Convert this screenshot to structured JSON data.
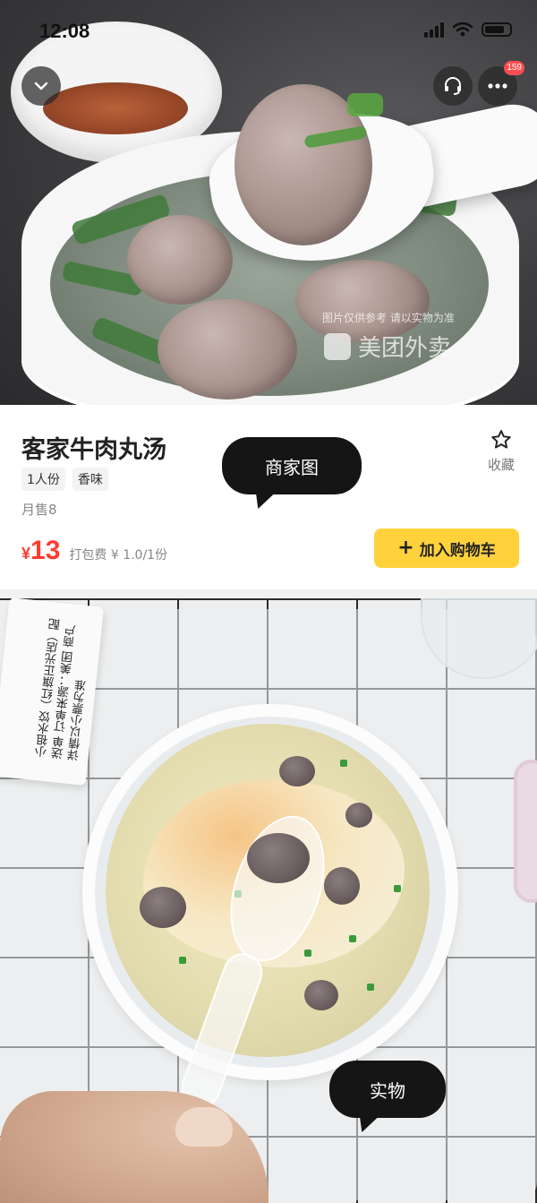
{
  "status_bar": {
    "time": "12:08"
  },
  "top_photo": {
    "more_badge": "159",
    "watermark_caption": "图片仅供参考 请以实物为准",
    "watermark_brand": "美团外卖"
  },
  "product": {
    "name": "客家牛肉丸汤",
    "tags": [
      "1人份",
      "香味"
    ],
    "monthly_sales": "月售8",
    "price_currency": "¥",
    "price_value": "13",
    "packaging_fee": "打包费 ¥ 1.0/1份",
    "favorite_label": "收藏",
    "add_to_cart_label": "加入购物车"
  },
  "labels": {
    "merchant_photo": "商家图",
    "real_photo": "实物"
  },
  "receipt_text": "小祖水饺（红旗正光店）配送单 订单来源：美团 商户详情以小票为准",
  "colors": {
    "price": "#ff3b30",
    "cart_button": "#ffd23c",
    "badge": "#ff4d4f"
  }
}
